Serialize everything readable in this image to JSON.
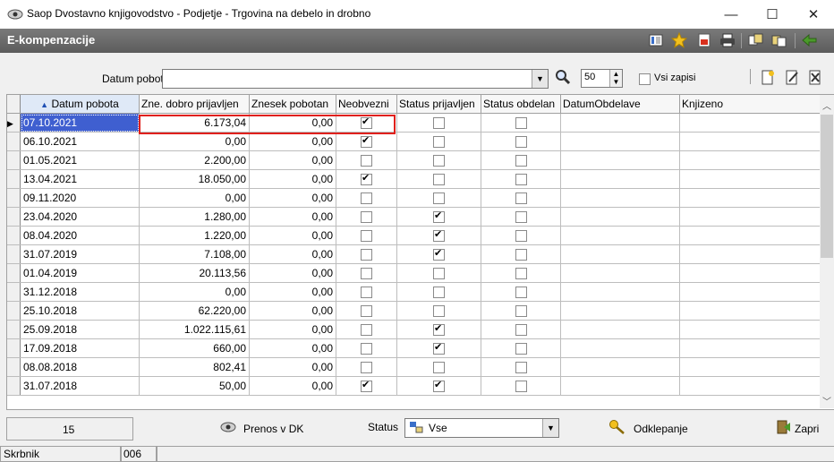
{
  "window": {
    "title": "Saop Dvostavno knjigovodstvo - Podjetje - Trgovina na debelo in drobno",
    "minimize": "—",
    "maximize": "☐",
    "close": "✕"
  },
  "caption": {
    "title": "E-kompenzacije"
  },
  "filter": {
    "label": "Datum pobota",
    "value": "",
    "count": "50",
    "all_records_label": "Vsi zapisi"
  },
  "grid": {
    "columns": [
      "Datum pobota",
      "Zne. dobro prijavljen",
      "Znesek pobotan",
      "Neobvezni",
      "Status prijavljen",
      "Status obdelan",
      "DatumObdelave",
      "Knjizeno"
    ],
    "sort_indicator": "▲",
    "rows": [
      {
        "date": "07.10.2021",
        "amount": "6.173,04",
        "offset": "0,00",
        "neob": true,
        "prij": false,
        "obd": false
      },
      {
        "date": "06.10.2021",
        "amount": "0,00",
        "offset": "0,00",
        "neob": true,
        "prij": false,
        "obd": false
      },
      {
        "date": "01.05.2021",
        "amount": "2.200,00",
        "offset": "0,00",
        "neob": false,
        "prij": false,
        "obd": false
      },
      {
        "date": "13.04.2021",
        "amount": "18.050,00",
        "offset": "0,00",
        "neob": true,
        "prij": false,
        "obd": false
      },
      {
        "date": "09.11.2020",
        "amount": "0,00",
        "offset": "0,00",
        "neob": false,
        "prij": false,
        "obd": false
      },
      {
        "date": "23.04.2020",
        "amount": "1.280,00",
        "offset": "0,00",
        "neob": false,
        "prij": true,
        "obd": false
      },
      {
        "date": "08.04.2020",
        "amount": "1.220,00",
        "offset": "0,00",
        "neob": false,
        "prij": true,
        "obd": false
      },
      {
        "date": "31.07.2019",
        "amount": "7.108,00",
        "offset": "0,00",
        "neob": false,
        "prij": true,
        "obd": false
      },
      {
        "date": "01.04.2019",
        "amount": "20.113,56",
        "offset": "0,00",
        "neob": false,
        "prij": false,
        "obd": false
      },
      {
        "date": "31.12.2018",
        "amount": "0,00",
        "offset": "0,00",
        "neob": false,
        "prij": false,
        "obd": false
      },
      {
        "date": "25.10.2018",
        "amount": "62.220,00",
        "offset": "0,00",
        "neob": false,
        "prij": false,
        "obd": false
      },
      {
        "date": "25.09.2018",
        "amount": "1.022.115,61",
        "offset": "0,00",
        "neob": false,
        "prij": true,
        "obd": false
      },
      {
        "date": "17.09.2018",
        "amount": "660,00",
        "offset": "0,00",
        "neob": false,
        "prij": true,
        "obd": false
      },
      {
        "date": "08.08.2018",
        "amount": "802,41",
        "offset": "0,00",
        "neob": false,
        "prij": false,
        "obd": false
      },
      {
        "date": "31.07.2018",
        "amount": "50,00",
        "offset": "0,00",
        "neob": true,
        "prij": true,
        "obd": false
      }
    ]
  },
  "footer": {
    "record_count": "15",
    "transfer_button": "Prenos v DK",
    "status_label": "Status",
    "status_value": "Vse",
    "unlock_button": "Odklepanje",
    "close_button": "Zapri"
  },
  "statusbar": {
    "user_label": "Skrbnik",
    "code": "006"
  },
  "colors": {
    "selection": "#3f5fd0",
    "highlight": "#e0201c",
    "caption": "#6a6a6a"
  }
}
